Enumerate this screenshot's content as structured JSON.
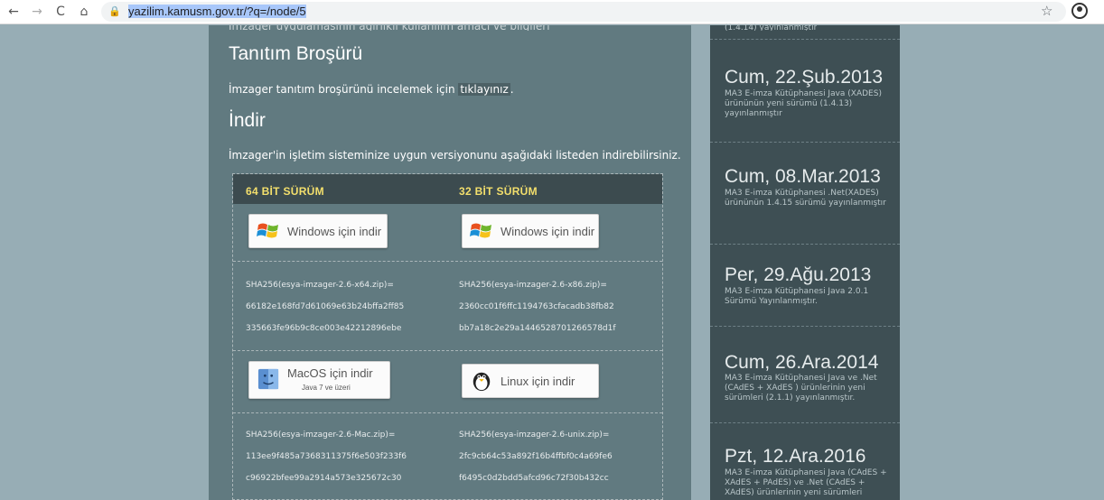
{
  "browser": {
    "url": "yazilim.kamusm.gov.tr/?q=/node/5",
    "back_icon": "←",
    "forward_icon": "→",
    "reload_icon": "C",
    "home_icon": "⌂",
    "lock_icon": "🔒",
    "star_icon": "☆"
  },
  "main": {
    "cutoff_text": "İmzager uygulamasının ağırlıklı kullanılım amacı ve bilgileri",
    "brochure_title": "Tanıtım Broşürü",
    "brochure_text": "İmzager tanıtım broşürünü incelemek için",
    "brochure_link": "tıklayınız",
    "brochure_end": ".",
    "download_title": "İndir",
    "download_text": "İmzager'in işletim sisteminize uygun versiyonunu aşağıdaki listeden indirebilirsiniz."
  },
  "downloads": {
    "col64": "64 BİT SÜRÜM",
    "col32": "32 BİT SÜRÜM",
    "win64_label": "Windows için indir",
    "win32_label": "Windows için indir",
    "hash_win64": [
      "SHA256(esya-imzager-2.6-x64.zip)=",
      "66182e168fd7d61069e63b24bffa2ff85",
      "335663fe96b9c8ce003e42212896ebe"
    ],
    "hash_win32": [
      "SHA256(esya-imzager-2.6-x86.zip)=",
      "2360cc01f6ffc1194763cfacadb38fb82",
      "bb7a18c2e29a1446528701266578d1f"
    ],
    "mac_label": "MacOS için indir",
    "mac_sub": "Java 7 ve üzeri",
    "linux_label": "Linux için indir",
    "hash_mac": [
      "SHA256(esya-imzager-2.6-Mac.zip)=",
      "113ee9f485a7368311375f6e503f233f6",
      "c96922bfee99a2914a573e325672c30"
    ],
    "hash_linux": [
      "SHA256(esya-imzager-2.6-unix.zip)=",
      "2fc9cb64c53a892f16b4ffbf0c4a69fe6",
      "f6495c0d2bdd5afcd96c72f30b432cc"
    ]
  },
  "news": {
    "cutoff_text": "(1.4.14) yayınlanmıştır",
    "items": [
      {
        "date": "Cum, 22.Şub.2013",
        "text": "MA3 E-imza Kütüphanesi Java (XADES) ürününün yeni sürümü (1.4.13) yayınlanmıştır"
      },
      {
        "date": "Cum, 08.Mar.2013",
        "text": "MA3 E-imza Kütüphanesi .Net(XADES) ürününün 1.4.15 sürümü yayınlanmıştır"
      },
      {
        "date": "Per, 29.Ağu.2013",
        "text": "MA3 E-imza Kütüphanesi Java 2.0.1 Sürümü Yayınlanmıştır."
      },
      {
        "date": "Cum, 26.Ara.2014",
        "text": "MA3 E-imza Kütüphanesi Java ve .Net (CAdES + XAdES ) ürünlerinin yeni sürümleri (2.1.1) yayınlanmıştır."
      },
      {
        "date": "Pzt, 12.Ara.2016",
        "text": "MA3 E-imza Kütüphanesi Java (CAdES + XAdES + PAdES) ve .Net (CAdES + XAdES) ürünlerinin yeni sürümleri"
      }
    ]
  }
}
